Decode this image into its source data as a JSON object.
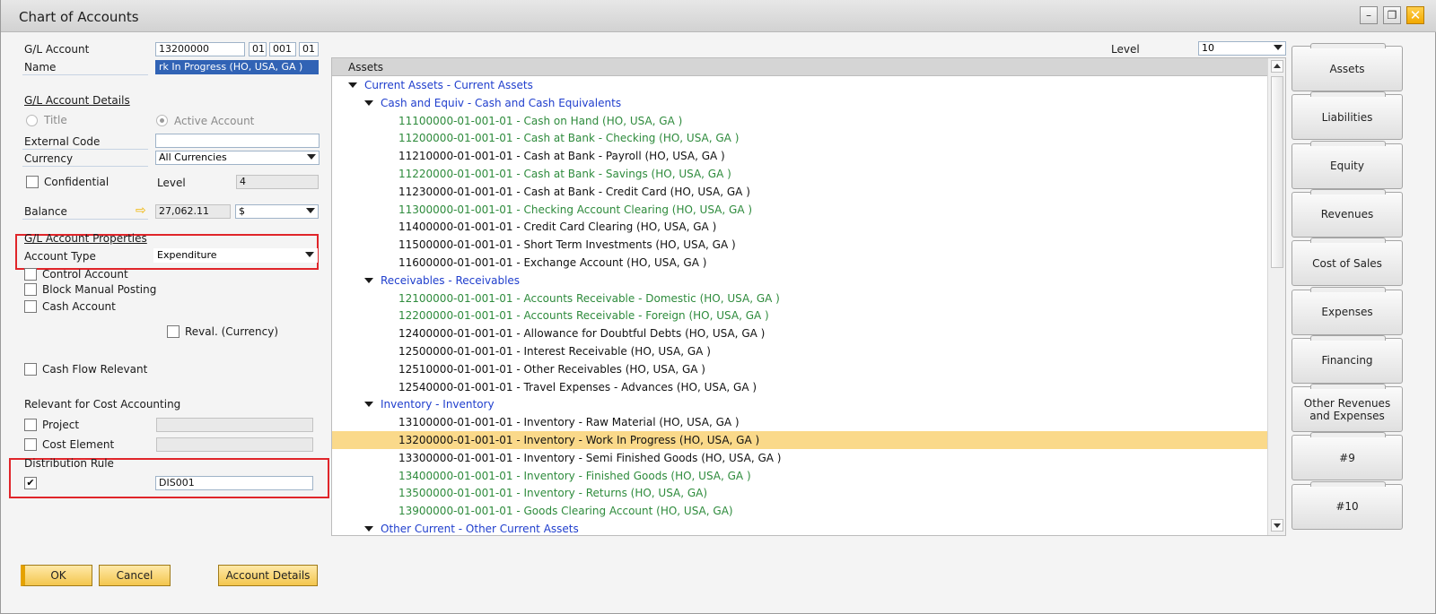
{
  "window": {
    "title": "Chart of Accounts"
  },
  "form": {
    "gl_account_label": "G/L Account",
    "gl_account_segments": [
      "13200000",
      "01",
      "001",
      "01"
    ],
    "name_label": "Name",
    "name_value": "rk In Progress (HO, USA, GA )",
    "details_header": "G/L Account Details",
    "title_option": "Title",
    "active_account_option": "Active Account",
    "external_code_label": "External Code",
    "external_code_value": "",
    "currency_label": "Currency",
    "currency_value": "All Currencies",
    "confidential_label": "Confidential",
    "level_label": "Level",
    "level_value": "4",
    "balance_label": "Balance",
    "balance_value": "27,062.11",
    "balance_currency": "$",
    "properties_header": "G/L Account Properties",
    "account_type_label": "Account Type",
    "account_type_value": "Expenditure",
    "control_account_label": "Control Account",
    "block_manual_posting_label": "Block Manual Posting",
    "cash_account_label": "Cash Account",
    "reval_label": "Reval. (Currency)",
    "cash_flow_label": "Cash Flow Relevant",
    "cost_accounting_header": "Relevant for Cost Accounting",
    "project_label": "Project",
    "cost_element_label": "Cost Element",
    "distribution_rule_label": "Distribution Rule",
    "distribution_rule_value": "DIS001",
    "distribution_rule_checked": "✔"
  },
  "level_selector": {
    "label": "Level",
    "value": "10"
  },
  "tree": {
    "header": "Assets",
    "rows": [
      {
        "text": "Current Assets - Current Assets",
        "kind": "cat",
        "indent": 0
      },
      {
        "text": "Cash and Equiv - Cash and Cash Equivalents",
        "kind": "cat",
        "indent": 1
      },
      {
        "text": "11100000-01-001-01 - Cash on Hand (HO, USA, GA )",
        "kind": "green",
        "indent": 2
      },
      {
        "text": "11200000-01-001-01 - Cash at Bank - Checking (HO, USA, GA )",
        "kind": "green",
        "indent": 2
      },
      {
        "text": "11210000-01-001-01 - Cash at Bank - Payroll (HO, USA, GA )",
        "kind": "black",
        "indent": 2
      },
      {
        "text": "11220000-01-001-01 - Cash at Bank - Savings (HO, USA, GA )",
        "kind": "green",
        "indent": 2
      },
      {
        "text": "11230000-01-001-01 - Cash at Bank - Credit Card (HO, USA, GA )",
        "kind": "black",
        "indent": 2
      },
      {
        "text": "11300000-01-001-01 - Checking Account Clearing (HO, USA, GA )",
        "kind": "green",
        "indent": 2
      },
      {
        "text": "11400000-01-001-01 - Credit Card Clearing (HO, USA, GA )",
        "kind": "black",
        "indent": 2
      },
      {
        "text": "11500000-01-001-01 - Short Term Investments (HO, USA, GA )",
        "kind": "black",
        "indent": 2
      },
      {
        "text": "11600000-01-001-01 - Exchange Account (HO, USA, GA )",
        "kind": "black",
        "indent": 2
      },
      {
        "text": "Receivables - Receivables",
        "kind": "cat",
        "indent": 1
      },
      {
        "text": "12100000-01-001-01 - Accounts Receivable - Domestic (HO, USA, GA )",
        "kind": "green",
        "indent": 2
      },
      {
        "text": "12200000-01-001-01 - Accounts Receivable - Foreign (HO, USA, GA )",
        "kind": "green",
        "indent": 2
      },
      {
        "text": "12400000-01-001-01 - Allowance for Doubtful Debts (HO, USA, GA )",
        "kind": "black",
        "indent": 2
      },
      {
        "text": "12500000-01-001-01 - Interest Receivable (HO, USA, GA )",
        "kind": "black",
        "indent": 2
      },
      {
        "text": "12510000-01-001-01 - Other Receivables (HO, USA, GA )",
        "kind": "black",
        "indent": 2
      },
      {
        "text": "12540000-01-001-01 - Travel Expenses - Advances (HO, USA, GA )",
        "kind": "black",
        "indent": 2
      },
      {
        "text": "Inventory - Inventory",
        "kind": "cat",
        "indent": 1
      },
      {
        "text": "13100000-01-001-01 - Inventory - Raw Material (HO, USA, GA )",
        "kind": "black",
        "indent": 2
      },
      {
        "text": "13200000-01-001-01 - Inventory - Work In Progress (HO, USA, GA )",
        "kind": "black",
        "indent": 2,
        "selected": true
      },
      {
        "text": "13300000-01-001-01 - Inventory - Semi Finished Goods (HO, USA, GA )",
        "kind": "black",
        "indent": 2
      },
      {
        "text": "13400000-01-001-01 - Inventory - Finished Goods (HO, USA, GA )",
        "kind": "green",
        "indent": 2
      },
      {
        "text": "13500000-01-001-01 - Inventory - Returns (HO, USA, GA)",
        "kind": "green",
        "indent": 2
      },
      {
        "text": "13900000-01-001-01 - Goods Clearing Account (HO, USA, GA)",
        "kind": "green",
        "indent": 2
      },
      {
        "text": "Other Current - Other Current Assets",
        "kind": "cat",
        "indent": 1
      }
    ]
  },
  "tabs": [
    "Assets",
    "Liabilities",
    "Equity",
    "Revenues",
    "Cost of Sales",
    "Expenses",
    "Financing",
    "Other Revenues and Expenses",
    "#9",
    "#10"
  ],
  "buttons": {
    "ok": "OK",
    "cancel": "Cancel",
    "account_details": "Account Details"
  },
  "icons": {
    "minimize": "minimize-icon",
    "maximize": "maximize-icon",
    "close": "close-icon",
    "link_arrow": "link-arrow-icon",
    "dropdown": "chevron-down-icon"
  },
  "colors": {
    "highlight_row": "#fad98a",
    "category_text": "#1f3ecd",
    "active_account_text": "#2e8b3c",
    "button_fill": "#f3c64e",
    "callout_border": "#e0252a"
  }
}
